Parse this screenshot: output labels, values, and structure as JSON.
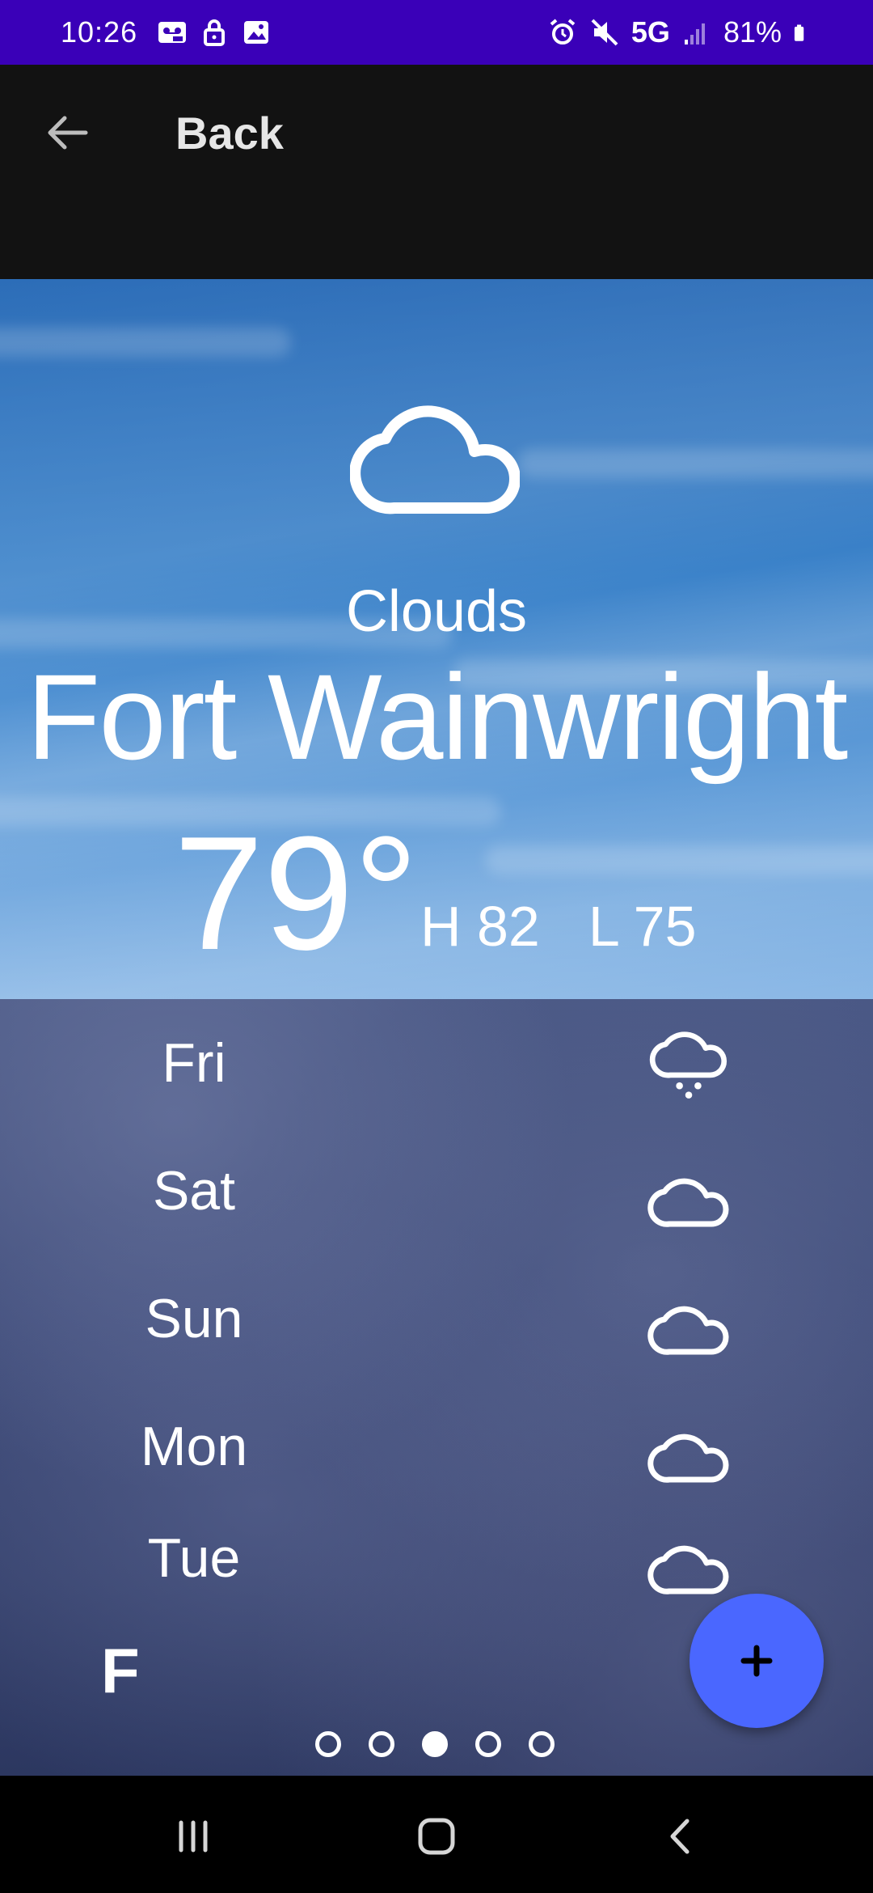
{
  "status_bar": {
    "time": "10:26",
    "network": "5G",
    "battery": "81%",
    "icons_left": [
      "voicemail-icon",
      "lock-icon",
      "image-icon"
    ],
    "icons_right": [
      "alarm-icon",
      "mute-icon",
      "signal-icon",
      "battery-icon"
    ],
    "background": "#3a00b8"
  },
  "app_bar": {
    "back_label": "Back",
    "background": "#121212"
  },
  "current": {
    "icon": "cloud-icon",
    "condition": "Clouds",
    "city": "Fort Wainwright",
    "temperature": "79°",
    "high": "H 82",
    "low": "L 75"
  },
  "forecast": [
    {
      "day": "Fri",
      "icon": "rain-cloud-icon"
    },
    {
      "day": "Sat",
      "icon": "cloud-icon"
    },
    {
      "day": "Sun",
      "icon": "cloud-icon"
    },
    {
      "day": "Mon",
      "icon": "cloud-icon"
    },
    {
      "day": "Tue",
      "icon": "cloud-icon"
    }
  ],
  "unit_label": "F",
  "fab": {
    "icon": "plus-icon",
    "color": "#4a67ff"
  },
  "pagination": {
    "count": 5,
    "active_index": 2
  },
  "nav_bar": {
    "buttons": [
      "recent-apps-icon",
      "home-icon",
      "back-icon"
    ]
  }
}
